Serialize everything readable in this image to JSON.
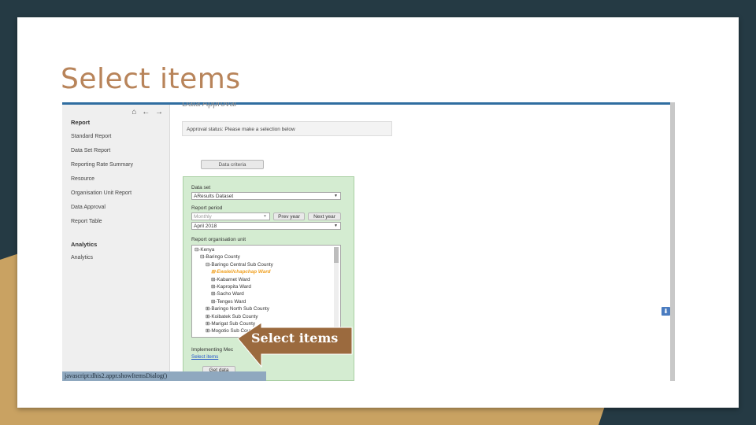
{
  "slide": {
    "title": "Select items"
  },
  "sidebar": {
    "nav_icons": "⌂ ← →",
    "sections": [
      {
        "heading": "Report",
        "items": [
          "Standard Report",
          "Data Set Report",
          "Reporting Rate Summary",
          "Resource",
          "Organisation Unit Report",
          "Data Approval",
          "Report Table"
        ]
      },
      {
        "heading": "Analytics",
        "items": [
          "Analytics"
        ]
      }
    ]
  },
  "main": {
    "heading": "Data Approval",
    "approval_status": "Approval status:   Please make a selection below",
    "data_criteria_button": "Data criteria",
    "form": {
      "data_set_label": "Data set",
      "data_set_value": "AResults Dataset",
      "report_period_label": "Report period",
      "period_type_value": "Monthly",
      "prev_year_button": "Prev year",
      "next_year_button": "Next year",
      "period_value": "April 2018",
      "org_unit_label": "Report organisation unit",
      "tree": [
        {
          "label": "⊟-Kenya",
          "indent": 0,
          "active": false
        },
        {
          "label": "⊟-Baringo County",
          "indent": 1,
          "active": false
        },
        {
          "label": "⊟-Baringo Central Sub County",
          "indent": 2,
          "active": false
        },
        {
          "label": "⊞-Ewalel/chapchap Ward",
          "indent": 3,
          "active": true
        },
        {
          "label": "⊞-Kabarnet Ward",
          "indent": 3,
          "active": false
        },
        {
          "label": "⊞-Kapropita Ward",
          "indent": 3,
          "active": false
        },
        {
          "label": "⊞-Sacho Ward",
          "indent": 3,
          "active": false
        },
        {
          "label": "⊞-Tenges Ward",
          "indent": 3,
          "active": false
        },
        {
          "label": "⊞-Baringo North Sub County",
          "indent": 2,
          "active": false
        },
        {
          "label": "⊞-Koibatek Sub County",
          "indent": 2,
          "active": false
        },
        {
          "label": "⊞-Marigat Sub County",
          "indent": 2,
          "active": false
        },
        {
          "label": "⊞-Mogotio Sub County",
          "indent": 2,
          "active": false
        }
      ],
      "implementing_label": "Implementing Mec",
      "select_items_link": "Select items",
      "get_data_button": "Get data"
    }
  },
  "statusbar": {
    "text": "javascript:dhis2.appr.showItemsDialog()"
  },
  "callout": {
    "text": "Select items"
  },
  "colors": {
    "title": "#b8845a",
    "panel": "#d4ecd1",
    "accent": "#2f6da0",
    "callout_fill": "#9b6a3e"
  }
}
